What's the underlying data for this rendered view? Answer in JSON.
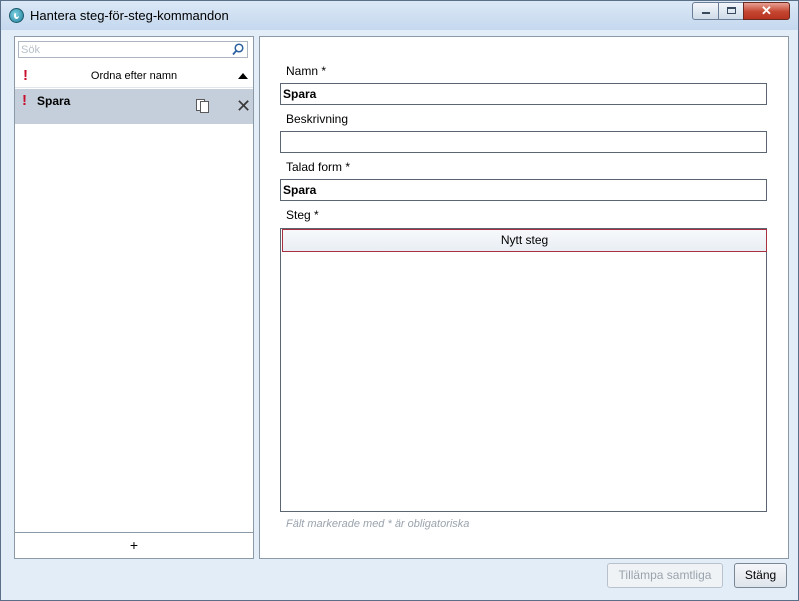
{
  "window": {
    "title": "Hantera steg-för-steg-kommandon",
    "close_glyph": "✕"
  },
  "sidebar": {
    "search_placeholder": "Sök",
    "search_value": "",
    "sort_label": "Ordna efter namn",
    "sort_warning": "!",
    "items": [
      {
        "label": "Spara",
        "warning": "!",
        "delete_glyph": "✕"
      }
    ],
    "add_label": "+"
  },
  "form": {
    "name_label": "Namn *",
    "name_value": "Spara",
    "description_label": "Beskrivning",
    "description_value": "",
    "spoken_label": "Talad form *",
    "spoken_value": "Spara",
    "steps_label": "Steg *",
    "new_step_label": "Nytt steg",
    "footnote": "Fält markerade med * är obligatoriska"
  },
  "footer": {
    "apply_label": "Tillämpa samtliga",
    "close_label": "Stäng"
  },
  "colors": {
    "warning": "#c8102e",
    "selected_item": "#c5cfdb",
    "new_step_border": "#a83141"
  }
}
